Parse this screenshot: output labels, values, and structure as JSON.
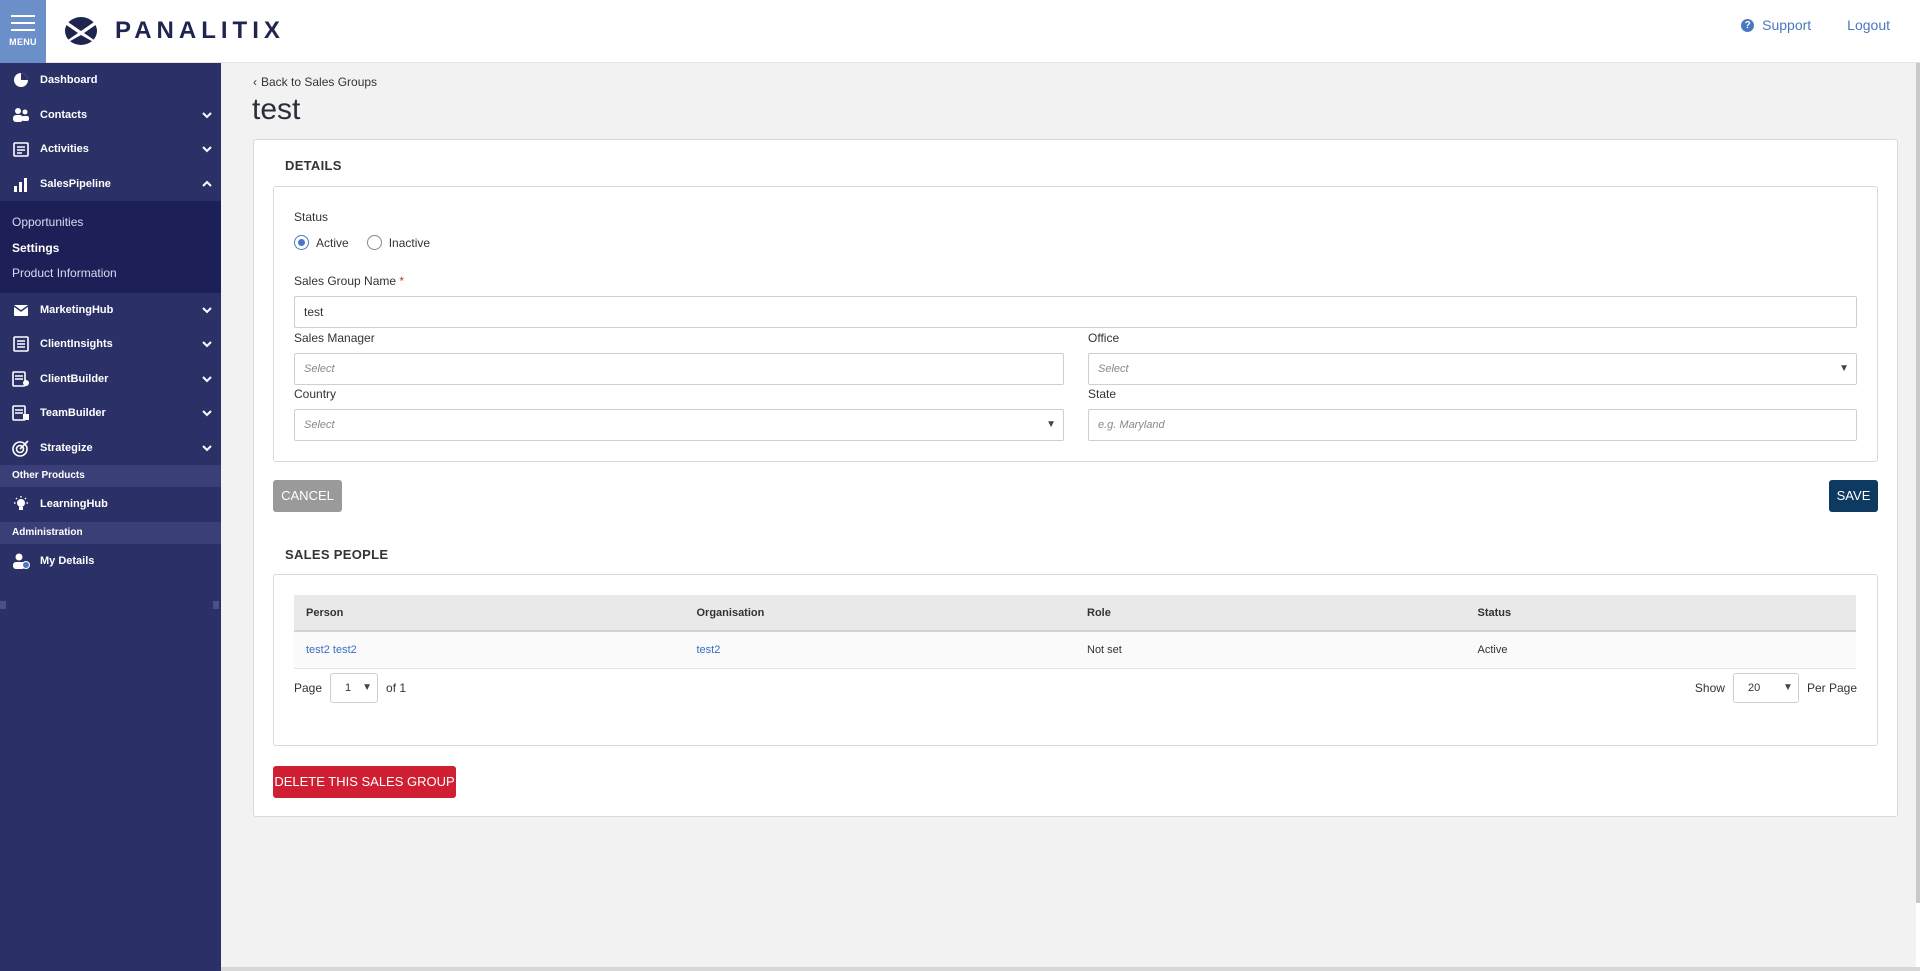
{
  "header": {
    "menu_label": "MENU",
    "brand": "PANALITIX",
    "support": "Support",
    "logout": "Logout"
  },
  "sidebar": {
    "items": [
      {
        "label": "Dashboard",
        "icon": "dashboard-icon"
      },
      {
        "label": "Contacts",
        "icon": "contacts-icon"
      },
      {
        "label": "Activities",
        "icon": "activities-icon"
      },
      {
        "label": "SalesPipeline",
        "icon": "sales-pipeline-icon"
      }
    ],
    "sub_items": [
      "Opportunities",
      "Settings",
      "Product Information"
    ],
    "items2": [
      {
        "label": "MarketingHub",
        "icon": "marketing-hub-icon"
      },
      {
        "label": "ClientInsights",
        "icon": "client-insights-icon"
      },
      {
        "label": "ClientBuilder",
        "icon": "client-builder-icon"
      },
      {
        "label": "TeamBuilder",
        "icon": "team-builder-icon"
      },
      {
        "label": "Strategize",
        "icon": "strategize-icon"
      }
    ],
    "other_products": "Other Products",
    "learning_hub": "LearningHub",
    "administration": "Administration",
    "my_details": "My Details"
  },
  "page": {
    "back_link": "Back to Sales Groups",
    "title": "test"
  },
  "details": {
    "heading": "DETAILS",
    "status_label": "Status",
    "status_options": [
      "Active",
      "Inactive"
    ],
    "status_selected": "Active",
    "name_label": "Sales Group Name",
    "name_required": "*",
    "name_value": "test",
    "manager_label": "Sales Manager",
    "manager_placeholder": "Select",
    "office_label": "Office",
    "office_placeholder": "Select",
    "country_label": "Country",
    "country_placeholder": "Select",
    "state_label": "State",
    "state_placeholder": "e.g. Maryland"
  },
  "actions": {
    "cancel": "CANCEL",
    "save": "SAVE",
    "delete": "DELETE THIS SALES GROUP"
  },
  "sales_people": {
    "heading": "SALES PEOPLE",
    "columns": [
      "Person",
      "Organisation",
      "Role",
      "Status"
    ],
    "rows": [
      {
        "person": "test2 test2",
        "organisation": "test2",
        "role": "Not set",
        "status": "Active"
      }
    ],
    "pager": {
      "page_label": "Page",
      "page_value": "1",
      "of_label": "of 1",
      "show_label": "Show",
      "per_page_value": "20",
      "per_page_label": "Per Page"
    }
  },
  "colors": {
    "sidebar": "#2b3166",
    "sidebar_active": "#1d2056",
    "save": "#0e3a62",
    "delete": "#d01f32",
    "link": "#3a6fc2"
  }
}
